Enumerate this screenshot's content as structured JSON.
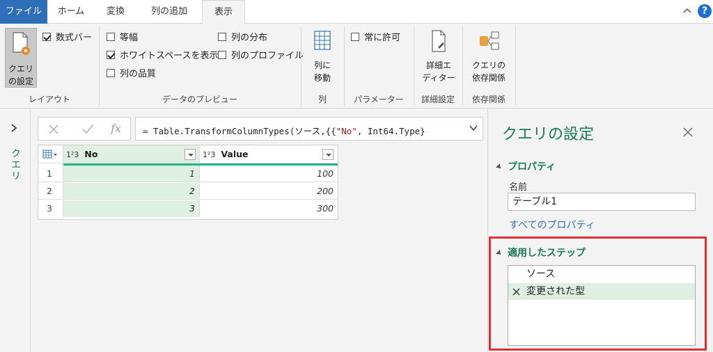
{
  "tabs": [
    {
      "label": "ファイル"
    },
    {
      "label": "ホーム"
    },
    {
      "label": "変換"
    },
    {
      "label": "列の追加"
    },
    {
      "label": "表示"
    }
  ],
  "help_label": "?",
  "ribbon": {
    "layout": {
      "query_settings_label_line1": "クエリ",
      "query_settings_label_line2": "の設定",
      "formula_bar_label": "数式バー",
      "group_label": "レイアウト"
    },
    "preview": {
      "monospace": "等幅",
      "show_whitespace": "ホワイトスペースを表示",
      "column_quality": "列の品質",
      "column_distribution": "列の分布",
      "column_profile": "列のプロファイル",
      "group_label": "データのプレビュー"
    },
    "columns": {
      "goto_line1": "列に",
      "goto_line2": "移動",
      "group_label": "列"
    },
    "parameters": {
      "always_allow": "常に許可",
      "group_label": "パラメーター"
    },
    "advanced": {
      "editor_line1": "詳細エ",
      "editor_line2": "ディター",
      "group_label": "詳細設定"
    },
    "dependencies": {
      "button_line1": "クエリの",
      "button_line2": "依存関係",
      "group_label": "依存関係"
    }
  },
  "left_pane_label": "クエリ",
  "formula": {
    "prefix": "= Table.TransformColumnTypes(ソース,{{",
    "str": "\"No\"",
    "suffix": ", Int64.Type}"
  },
  "table": {
    "type_icon": "1²3",
    "columns": [
      "No",
      "Value"
    ],
    "rows": [
      {
        "index": "1",
        "No": "1",
        "Value": "100"
      },
      {
        "index": "2",
        "No": "2",
        "Value": "200"
      },
      {
        "index": "3",
        "No": "3",
        "Value": "300"
      }
    ]
  },
  "query_settings": {
    "title": "クエリの設定",
    "properties_header": "プロパティ",
    "name_label": "名前",
    "name_value": "テーブル1",
    "all_properties_link": "すべてのプロパティ",
    "applied_steps_header": "適用したステップ",
    "steps": [
      {
        "label": "ソース"
      },
      {
        "label": "変更された型"
      }
    ]
  },
  "colors": {
    "accent_green": "#1c7a5a",
    "file_tab_blue": "#2e6fb7",
    "highlight_red": "#e03030"
  }
}
